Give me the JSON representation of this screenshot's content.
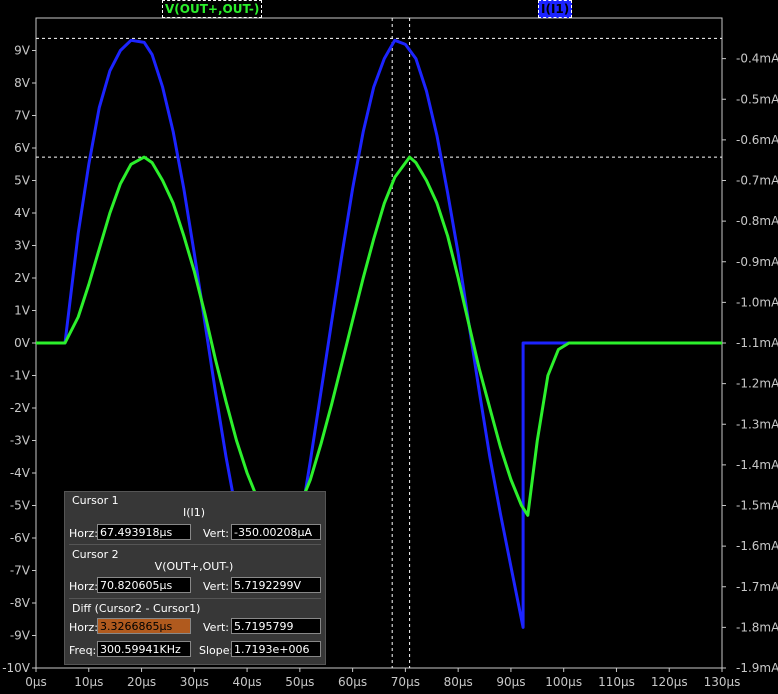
{
  "trace_labels": {
    "voltage": "V(OUT+,OUT-)",
    "current": "I(I1)"
  },
  "colors": {
    "background": "#000000",
    "axis": "#c8c8c8",
    "voltage_trace": "#2cf02c",
    "current_trace": "#1c24ff",
    "cursor": "#ffffff"
  },
  "cursor_panel": {
    "cursor1": {
      "title": "Cursor 1",
      "trace": "I(I1)",
      "horz_label": "Horz:",
      "horz": "67.493918µs",
      "vert_label": "Vert:",
      "vert": "-350.00208µA"
    },
    "cursor2": {
      "title": "Cursor 2",
      "trace": "V(OUT+,OUT-)",
      "horz_label": "Horz:",
      "horz": "70.820605µs",
      "vert_label": "Vert:",
      "vert": "5.7192299V"
    },
    "diff": {
      "title": "Diff (Cursor2 - Cursor1)",
      "horz_label": "Horz:",
      "horz": "3.3266865µs",
      "vert_label": "Vert:",
      "vert": "5.7195799",
      "freq_label": "Freq:",
      "freq": "300.59941KHz",
      "slope_label": "Slope:",
      "slope": "1.7193e+006"
    }
  },
  "chart_data": {
    "type": "line",
    "x_unit": "µs",
    "xlim": [
      0,
      130
    ],
    "ylim_left": [
      -10,
      10
    ],
    "ylim_right": [
      -1.9,
      -0.3
    ],
    "x_ticks": [
      "0µs",
      "10µs",
      "20µs",
      "30µs",
      "40µs",
      "50µs",
      "60µs",
      "70µs",
      "80µs",
      "90µs",
      "100µs",
      "110µs",
      "120µs",
      "130µs"
    ],
    "y_ticks_left": [
      "9V",
      "8V",
      "7V",
      "6V",
      "5V",
      "4V",
      "3V",
      "2V",
      "1V",
      "0V",
      "-1V",
      "-2V",
      "-3V",
      "-4V",
      "-5V",
      "-6V",
      "-7V",
      "-8V",
      "-9V",
      "-10V"
    ],
    "y_ticks_right": [
      "-0.4mA",
      "-0.5mA",
      "-0.6mA",
      "-0.7mA",
      "-0.8mA",
      "-0.9mA",
      "-1.0mA",
      "-1.1mA",
      "-1.2mA",
      "-1.3mA",
      "-1.4mA",
      "-1.5mA",
      "-1.6mA",
      "-1.7mA",
      "-1.8mA",
      "-1.9mA"
    ],
    "grid": false,
    "series": [
      {
        "name": "V(OUT+,OUT-)",
        "axis": "left",
        "color": "#2cf02c",
        "x": [
          0,
          5.5,
          8,
          10,
          12,
          14,
          16,
          18,
          20.5,
          22,
          24,
          26,
          28,
          30,
          32,
          34,
          36,
          38,
          40,
          42,
          44.5,
          46,
          48,
          50,
          52,
          54,
          56,
          58,
          60,
          62,
          64,
          66,
          68,
          70.8,
          72,
          74,
          76,
          78,
          80,
          82,
          84,
          86,
          88,
          90,
          92,
          93.2,
          95,
          97,
          99,
          101,
          130
        ],
        "y": [
          0,
          0,
          0.8,
          1.8,
          2.9,
          4.0,
          4.9,
          5.5,
          5.72,
          5.55,
          5.0,
          4.3,
          3.3,
          2.2,
          0.9,
          -0.5,
          -1.8,
          -3.0,
          -4.0,
          -4.8,
          -5.5,
          -5.6,
          -5.45,
          -5.0,
          -4.2,
          -3.1,
          -1.9,
          -0.6,
          0.7,
          2.0,
          3.2,
          4.3,
          5.1,
          5.72,
          5.55,
          5.0,
          4.3,
          3.3,
          2.0,
          0.6,
          -0.8,
          -2.0,
          -3.2,
          -4.2,
          -5.0,
          -5.3,
          -3.0,
          -1.0,
          -0.2,
          0,
          0
        ]
      },
      {
        "name": "I(I1)",
        "axis": "right",
        "color": "#1c24ff",
        "x": [
          0,
          5.5,
          8,
          10,
          12,
          14,
          16,
          18,
          20.5,
          22,
          24,
          26,
          28,
          30,
          32,
          34,
          36,
          38,
          40,
          42,
          44.5,
          46,
          48,
          50,
          52,
          54,
          56,
          58,
          60,
          62,
          64,
          66,
          68,
          70,
          72,
          74,
          76,
          78,
          80,
          82,
          84,
          86,
          88,
          90,
          92.3,
          92.3,
          130
        ],
        "y": [
          -1.1,
          -1.1,
          -0.83,
          -0.66,
          -0.52,
          -0.43,
          -0.38,
          -0.355,
          -0.36,
          -0.39,
          -0.47,
          -0.58,
          -0.72,
          -0.88,
          -1.05,
          -1.22,
          -1.38,
          -1.52,
          -1.63,
          -1.72,
          -1.78,
          -1.75,
          -1.68,
          -1.55,
          -1.39,
          -1.22,
          -1.05,
          -0.88,
          -0.72,
          -0.58,
          -0.47,
          -0.4,
          -0.355,
          -0.365,
          -0.4,
          -0.48,
          -0.59,
          -0.73,
          -0.88,
          -1.05,
          -1.22,
          -1.38,
          -1.52,
          -1.65,
          -1.8,
          -1.1,
          -1.1
        ]
      }
    ],
    "cursors": [
      {
        "x": 67.5,
        "y_right": -0.35
      },
      {
        "x": 70.8,
        "y_left": 5.72
      }
    ]
  }
}
